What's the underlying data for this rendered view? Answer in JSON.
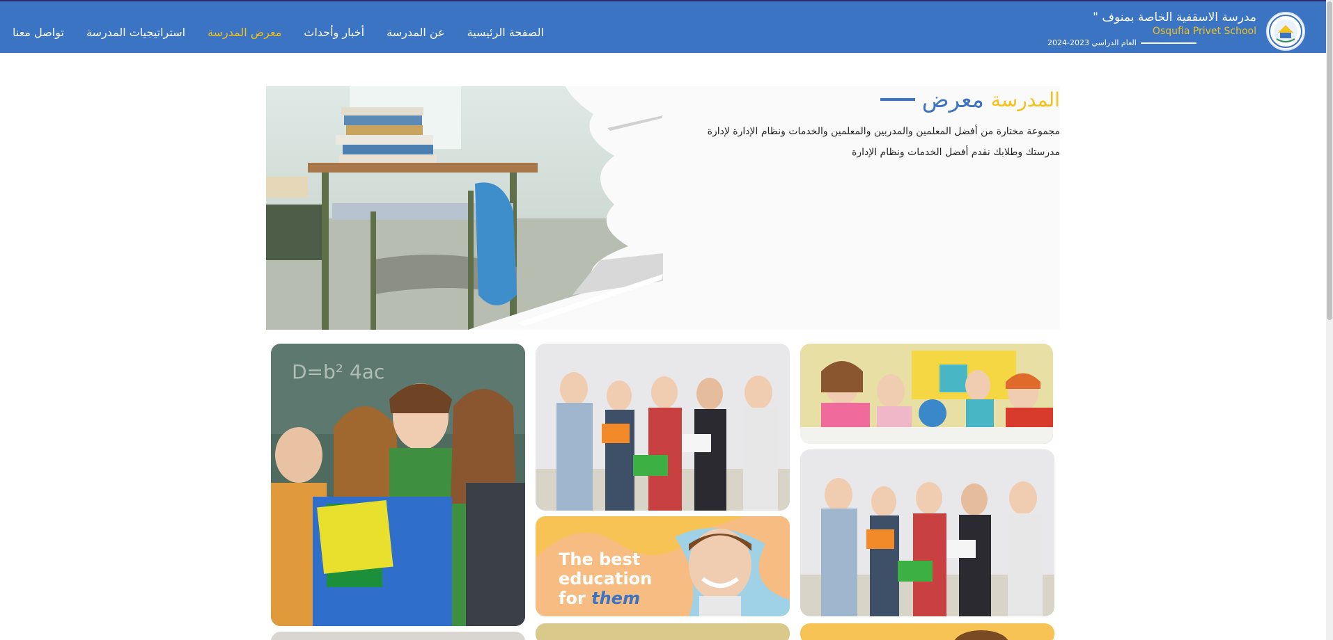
{
  "header": {
    "school_name_ar": "مدرسة الاسقفية الخاصة بمنوف \"",
    "school_name_en": "Osqufia Privet School",
    "academic_year": "العام الدراسي 2023-2024",
    "logo_icon": "school-logo-icon",
    "nav": [
      {
        "label": "الصفحة الرئيسية",
        "active": false
      },
      {
        "label": "عن المدرسة",
        "active": false
      },
      {
        "label": "أخبار وأحداث",
        "active": false
      },
      {
        "label": "معرض المدرسة",
        "active": true
      },
      {
        "label": "استراتيجيات المدرسة",
        "active": false
      },
      {
        "label": "تواصل معنا",
        "active": false
      }
    ]
  },
  "hero": {
    "title_part1": "معرض",
    "title_part2": "المدرسة",
    "description": "مجموعة مختارة من أفضل المعلمين والمدربين والمعلمين والخدمات ونظام الإدارة لإدارة مدرستك وطلابك نقدم أفضل الخدمات ونظام الإدارة"
  },
  "gallery": {
    "promo_line1": "The best",
    "promo_line2": "education",
    "promo_line3_a": "for",
    "promo_line3_b": "them"
  },
  "colors": {
    "primary": "#3a74c2",
    "accent": "#f4c21a",
    "header_border": "#2c2a6b"
  }
}
